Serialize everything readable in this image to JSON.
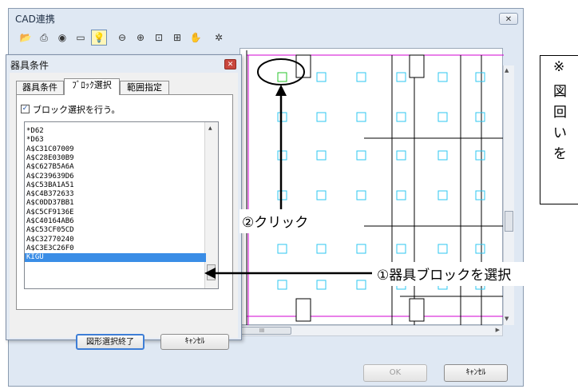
{
  "window": {
    "title": "CAD連携",
    "close_glyph": "✕"
  },
  "toolbar": {
    "icons": [
      "open-folder-icon",
      "print-icon",
      "layer-icon",
      "frame-icon",
      "lightbulb-icon",
      "zoom-out-icon",
      "zoom-in-icon",
      "zoom-window-icon",
      "zoom-fit-icon",
      "pan-hand-icon",
      "settings-gear-icon"
    ],
    "glyphs": [
      "📂",
      "⎙",
      "◉",
      "▭",
      "💡",
      "⊖",
      "⊕",
      "⊡",
      "⊞",
      "✋",
      "✲"
    ]
  },
  "canvas": {
    "dimensions": [
      "1250",
      "2500",
      "2500"
    ],
    "hscroll_thumb": "III"
  },
  "footer": {
    "ok_label": "OK",
    "cancel_label": "ｷｬﾝｾﾙ"
  },
  "dialog": {
    "title": "器具条件",
    "close_glyph": "✕",
    "tabs": [
      "器具条件",
      "ﾌﾞﾛｯｸ選択",
      "範囲指定"
    ],
    "checkbox": {
      "label": "ブロック選択を行う。",
      "checked": true,
      "mark": "✓"
    },
    "list_items": [
      "*D62",
      "*D63",
      "A$C31C07009",
      "A$C28E030B9",
      "A$C627B5A6A",
      "A$C239639D6",
      "A$C53BA1A51",
      "A$C4B372633",
      "A$C0DD37BB1",
      "A$C5CF9136E",
      "A$C40164AB6",
      "A$C53CF05CD",
      "A$C32770240",
      "A$C3E3C26F0",
      "KIGU"
    ],
    "selected_item": "KIGU",
    "finish_label": "図形選択終了",
    "cancel_label": "ｷｬﾝｾﾙ"
  },
  "annotations": {
    "click_label": "②クリック",
    "select_label": "①器具ブロックを選択",
    "note_lines": [
      "※",
      "図",
      "回",
      "い",
      "を"
    ]
  },
  "colors": {
    "magenta_line": "#d300d3",
    "fixture_cyan": "#2ec7f0",
    "fixture_selected": "#27c42b",
    "selection_blue": "#3a8de6"
  }
}
